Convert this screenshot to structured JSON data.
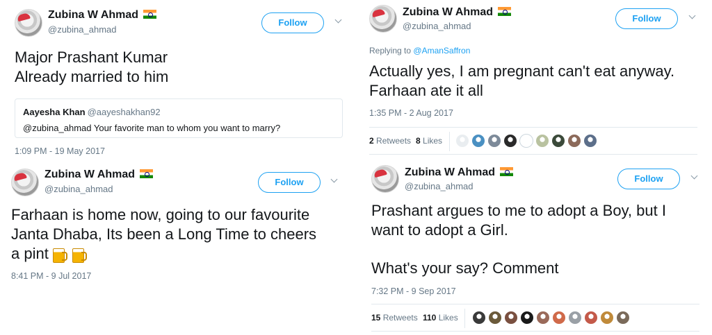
{
  "tweets": [
    {
      "name": "Zubina W Ahmad",
      "handle": "@zubina_ahmad",
      "follow": "Follow",
      "text_lines": [
        "Major Prashant Kumar",
        "Already married to him"
      ],
      "quote": {
        "name": "Aayesha Khan",
        "handle": "@aayeshakhan92",
        "text": "@zubina_ahmad Your favorite man to whom you want to marry?"
      },
      "time": "1:09 PM - 19 May 2017"
    },
    {
      "name": "Zubina W Ahmad",
      "handle": "@zubina_ahmad",
      "follow": "Follow",
      "text_lines": [
        "Farhaan is home now, going to our favourite",
        "Janta Dhaba, Its been a Long Time to cheers",
        "a pint"
      ],
      "emoji": [
        "beer-mug-icon",
        "beer-mug-icon"
      ],
      "time": "8:41 PM - 9 Jul 2017"
    },
    {
      "name": "Zubina W Ahmad",
      "handle": "@zubina_ahmad",
      "follow": "Follow",
      "reply_prefix": "Replying to",
      "reply_to": "@AmanSaffron",
      "text_lines": [
        "Actually yes, I am pregnant can't eat anyway.",
        "Farhaan ate it all"
      ],
      "time": "1:35 PM - 2 Aug 2017",
      "retweets_count": "2",
      "retweets_label": "Retweets",
      "likes_count": "8",
      "likes_label": "Likes",
      "liker_colors": [
        "#e9edf0",
        "#4a90c2",
        "#7d8a99",
        "#2a2a2a",
        "#ffffff",
        "#b9c2a0",
        "#3b4a3a",
        "#8c6a5a",
        "#5c6f8a"
      ]
    },
    {
      "name": "Zubina W Ahmad",
      "handle": "@zubina_ahmad",
      "follow": "Follow",
      "text_lines": [
        "Prashant argues to me to adopt a Boy, but I",
        "want to adopt a Girl.",
        "",
        "What's your say? Comment"
      ],
      "time": "7:32 PM - 9 Sep 2017",
      "retweets_count": "15",
      "retweets_label": "Retweets",
      "likes_count": "110",
      "likes_label": "Likes",
      "liker_colors": [
        "#3a3a3a",
        "#6b5a3a",
        "#7a5040",
        "#1a1a1a",
        "#9a6a5a",
        "#d06a4a",
        "#9aa0a6",
        "#c45a4a",
        "#c08a3a",
        "#7a6a5a"
      ]
    }
  ],
  "colors": {
    "accent": "#1da1f2",
    "muted": "#657786",
    "border": "#e1e8ed"
  }
}
